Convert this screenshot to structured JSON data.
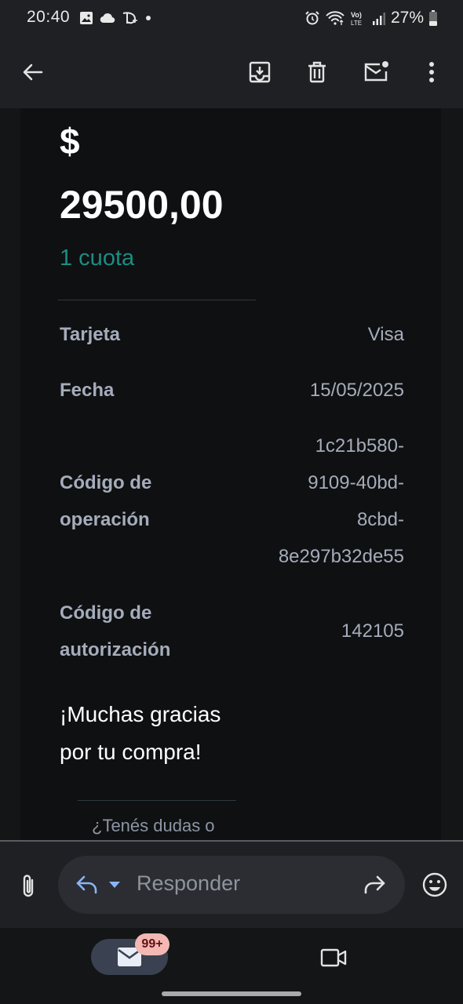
{
  "status_bar": {
    "time": "20:40",
    "battery": "27%",
    "left_icons": [
      "image-icon",
      "cloud-icon",
      "disney-plus-icon",
      "dot-icon"
    ],
    "right_icons": [
      "alarm-icon",
      "wifi-icon",
      "volte-icon",
      "signal-icon",
      "battery-icon"
    ]
  },
  "app_bar": {
    "icons": [
      "back-arrow-icon",
      "archive-icon",
      "delete-icon",
      "mark-unread-icon",
      "more-vert-icon"
    ]
  },
  "email": {
    "currency": "$",
    "amount": "29500,00",
    "installments": "1 cuota",
    "details": [
      {
        "label": "Tarjeta",
        "value": "Visa"
      },
      {
        "label": "Fecha",
        "value": "15/05/2025"
      },
      {
        "label_lines": [
          "Código de",
          "operación"
        ],
        "value_lines": [
          "1c21b580-",
          "9109-40bd-",
          "8cbd-",
          "8e297b32de55"
        ]
      },
      {
        "label_lines": [
          "Código de",
          "autorización"
        ],
        "value": "142105"
      }
    ],
    "thanks_lines": [
      "¡Muchas gracias",
      "por tu compra!"
    ],
    "help_partial": "¿Tenés dudas o"
  },
  "reply_bar": {
    "placeholder": "Responder"
  },
  "bottom_nav": {
    "mail_badge": "99+"
  },
  "colors": {
    "accent_teal": "#1c8d84",
    "badge_bg": "#f3b8b3",
    "reply_blue": "#8ab4f8"
  }
}
